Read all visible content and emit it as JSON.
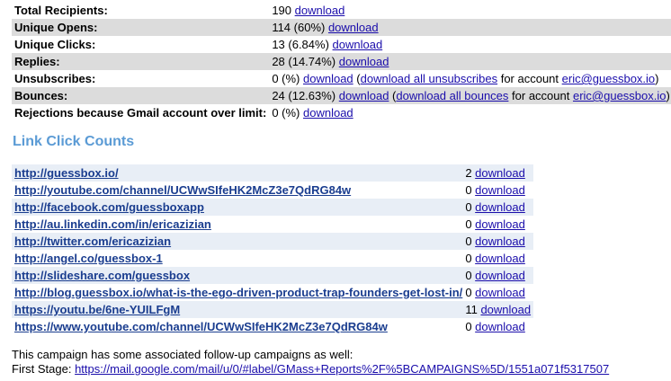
{
  "stats": [
    {
      "label": "Total Recipients:",
      "value": "190",
      "shade": false,
      "parts": [
        {
          "link": "download"
        }
      ]
    },
    {
      "label": "Unique Opens:",
      "value": "114 (60%)",
      "shade": true,
      "parts": [
        {
          "link": "download"
        }
      ]
    },
    {
      "label": "Unique Clicks:",
      "value": "13 (6.84%)",
      "shade": false,
      "parts": [
        {
          "link": "download"
        }
      ]
    },
    {
      "label": "Replies:",
      "value": "28 (14.74%)",
      "shade": true,
      "parts": [
        {
          "link": "download"
        }
      ]
    },
    {
      "label": "Unsubscribes:",
      "value": "0 (%)",
      "shade": false,
      "parts": [
        {
          "link": "download"
        },
        {
          "text": " ("
        },
        {
          "link": "download all unsubscribes"
        },
        {
          "text": " for account "
        },
        {
          "link": "eric@guessbox.io"
        },
        {
          "text": ")"
        }
      ]
    },
    {
      "label": "Bounces:",
      "value": "24 (12.63%)",
      "shade": true,
      "parts": [
        {
          "link": "download"
        },
        {
          "text": " ("
        },
        {
          "link": "download all bounces"
        },
        {
          "text": " for account "
        },
        {
          "link": "eric@guessbox.io"
        },
        {
          "text": ")"
        }
      ]
    },
    {
      "label": "Rejections because Gmail account over limit:",
      "value": "0 (%)",
      "shade": false,
      "parts": [
        {
          "link": "download"
        }
      ]
    }
  ],
  "link_section_title": "Link Click Counts",
  "links": [
    {
      "url": "http://guessbox.io/",
      "count": "2",
      "download": "download",
      "shade": true
    },
    {
      "url": "http://youtube.com/channel/UCWwSIfeHK2McZ3e7QdRG84w",
      "count": "0",
      "download": "download",
      "shade": false
    },
    {
      "url": "http://facebook.com/guessboxapp",
      "count": "0",
      "download": "download",
      "shade": true
    },
    {
      "url": "http://au.linkedin.com/in/ericazizian",
      "count": "0",
      "download": "download",
      "shade": false
    },
    {
      "url": "http://twitter.com/ericazizian",
      "count": "0",
      "download": "download",
      "shade": true
    },
    {
      "url": "http://angel.co/guessbox-1",
      "count": "0",
      "download": "download",
      "shade": false
    },
    {
      "url": "http://slideshare.com/guessbox",
      "count": "0",
      "download": "download",
      "shade": true
    },
    {
      "url": "http://blog.guessbox.io/what-is-the-ego-driven-product-trap-founders-get-lost-in/",
      "count": "0",
      "download": "download",
      "shade": false
    },
    {
      "url": "https://youtu.be/6ne-YUILFgM",
      "count": "11",
      "download": "download",
      "shade": true
    },
    {
      "url": "https://www.youtube.com/channel/UCWwSIfeHK2McZ3e7QdRG84w",
      "count": "0",
      "download": "download",
      "shade": false
    }
  ],
  "footer": {
    "note": "This campaign has some associated follow-up campaigns as well:",
    "stage_label": "First Stage: ",
    "stage_link": "https://mail.google.com/mail/u/0/#label/GMass+Reports%2F%5BCAMPAIGNS%5D/1551a071f5317507"
  }
}
